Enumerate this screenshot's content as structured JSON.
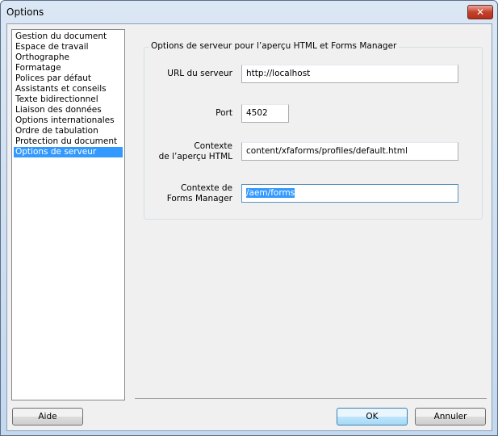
{
  "window": {
    "title": "Options",
    "close_label": "✕"
  },
  "sidebar": {
    "items": [
      {
        "label": "Gestion du document"
      },
      {
        "label": "Espace de travail"
      },
      {
        "label": "Orthographe"
      },
      {
        "label": "Formatage"
      },
      {
        "label": "Polices par défaut"
      },
      {
        "label": "Assistants et conseils"
      },
      {
        "label": "Texte bidirectionnel"
      },
      {
        "label": "Liaison des données"
      },
      {
        "label": "Options internationales"
      },
      {
        "label": "Ordre de tabulation"
      },
      {
        "label": "Protection du document"
      },
      {
        "label": "Options de serveur"
      }
    ],
    "selected": "Options de serveur"
  },
  "group": {
    "title": "Options de serveur pour l’aperçu HTML et Forms Manager",
    "url_label": "URL du serveur",
    "url_value": "http://localhost",
    "port_label": "Port",
    "port_value": "4502",
    "html_ctx_label_1": "Contexte",
    "html_ctx_label_2": "de l’aperçu HTML",
    "html_ctx_value": "content/xfaforms/profiles/default.html",
    "fm_ctx_label_1": "Contexte de",
    "fm_ctx_label_2": "Forms Manager",
    "fm_ctx_value": "/aem/forms"
  },
  "buttons": {
    "help": "Aide",
    "ok": "OK",
    "cancel": "Annuler"
  }
}
